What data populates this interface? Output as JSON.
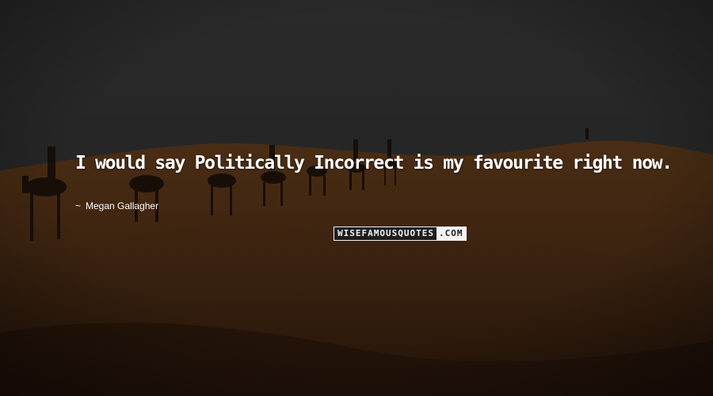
{
  "quote": {
    "text": "I would say Politically Incorrect is my favourite right now.",
    "author_prefix": "~",
    "author": "Megan Gallagher"
  },
  "watermark": {
    "brand": "WISEFAMOUSQUOTES",
    "tld": ".COM"
  },
  "colors": {
    "sky": "#262626",
    "sand": "#3b2412",
    "text": "#ffffff"
  },
  "background": {
    "scene": "desert dunes at dusk with a camel caravan"
  }
}
